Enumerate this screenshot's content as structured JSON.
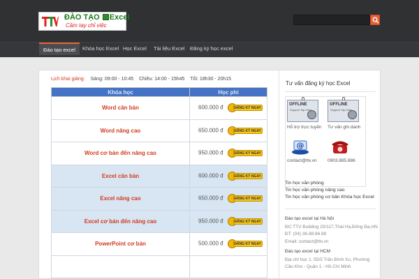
{
  "header": {
    "logo": {
      "badge": "TTV",
      "title_prefix": "ĐÀO TẠO",
      "title_suffix": "Excel",
      "slogan": "Cầm tay chỉ việc"
    },
    "search": {
      "placeholder": ""
    },
    "brand_color": "#e8623a"
  },
  "nav": {
    "items": [
      "Đào tạo excel",
      "Khóa học Excel",
      "Học Excel",
      "Tài liệu Excel",
      "Đăng ký học excel"
    ],
    "active_index": 0
  },
  "schedule": {
    "label": "Lịch khai giảng:",
    "morning": "Sáng: 09:00 - 10:45",
    "afternoon": "Chiều: 14:00 - 15h45",
    "evening": "Tối: 18h30 - 20h15"
  },
  "course_table": {
    "headers": [
      "Khóa học",
      "Học phí"
    ],
    "register_label": "ĐĂNG KÝ NGAY",
    "rows": [
      {
        "name": "Word căn bản",
        "price": "600.000 đ",
        "alt": false
      },
      {
        "name": "Word nâng cao",
        "price": "650.000 đ",
        "alt": false
      },
      {
        "name": "Word cơ bản đến nâng cao",
        "price": "950.000 đ",
        "alt": false
      },
      {
        "name": "Excel căn bản",
        "price": "600.000 đ",
        "alt": true
      },
      {
        "name": "Excel nâng cao",
        "price": "650.000 đ",
        "alt": true
      },
      {
        "name": "Excel cơ bản đến nâng cao",
        "price": "950.000 đ",
        "alt": true
      },
      {
        "name": "PowerPoint cơ bản",
        "price": "500.000 đ",
        "alt": false
      },
      {
        "name": "",
        "price": "",
        "alt": false
      }
    ]
  },
  "sidebar": {
    "title": "Tư vấn đăng ký học Excel",
    "support": {
      "offline_word": "OFFLINE",
      "offline_sub": "Support Tap Help",
      "online_caption": "Hỗ trợ trực tuyến",
      "reg_caption": "Tư vấn ghi danh",
      "email": "contact@ttv.vn",
      "phone": "0903.885.886"
    },
    "links": [
      "Tin học văn phòng",
      "Tin học văn phòng nâng cao",
      "Tin học văn phòng cơ bản Khóa học Excel"
    ],
    "hanoi": {
      "head": "Đào tạo excel tại Hà Nội",
      "line1": "ĐC:TTV Building 20/117,Thái Hà,Đống Đa,HN",
      "line2": "ĐT: (04) 36.88.66.88",
      "line3": "Email: contact@ttv.vn"
    },
    "hcm": {
      "head": "Đào tạo excel tại HCM",
      "line1": "Địa chỉ học 1: 55/5 Trần Đình Xu, Phường",
      "line2": "Cầu Kho - Quận 1 - Hồ Chí Minh"
    }
  }
}
